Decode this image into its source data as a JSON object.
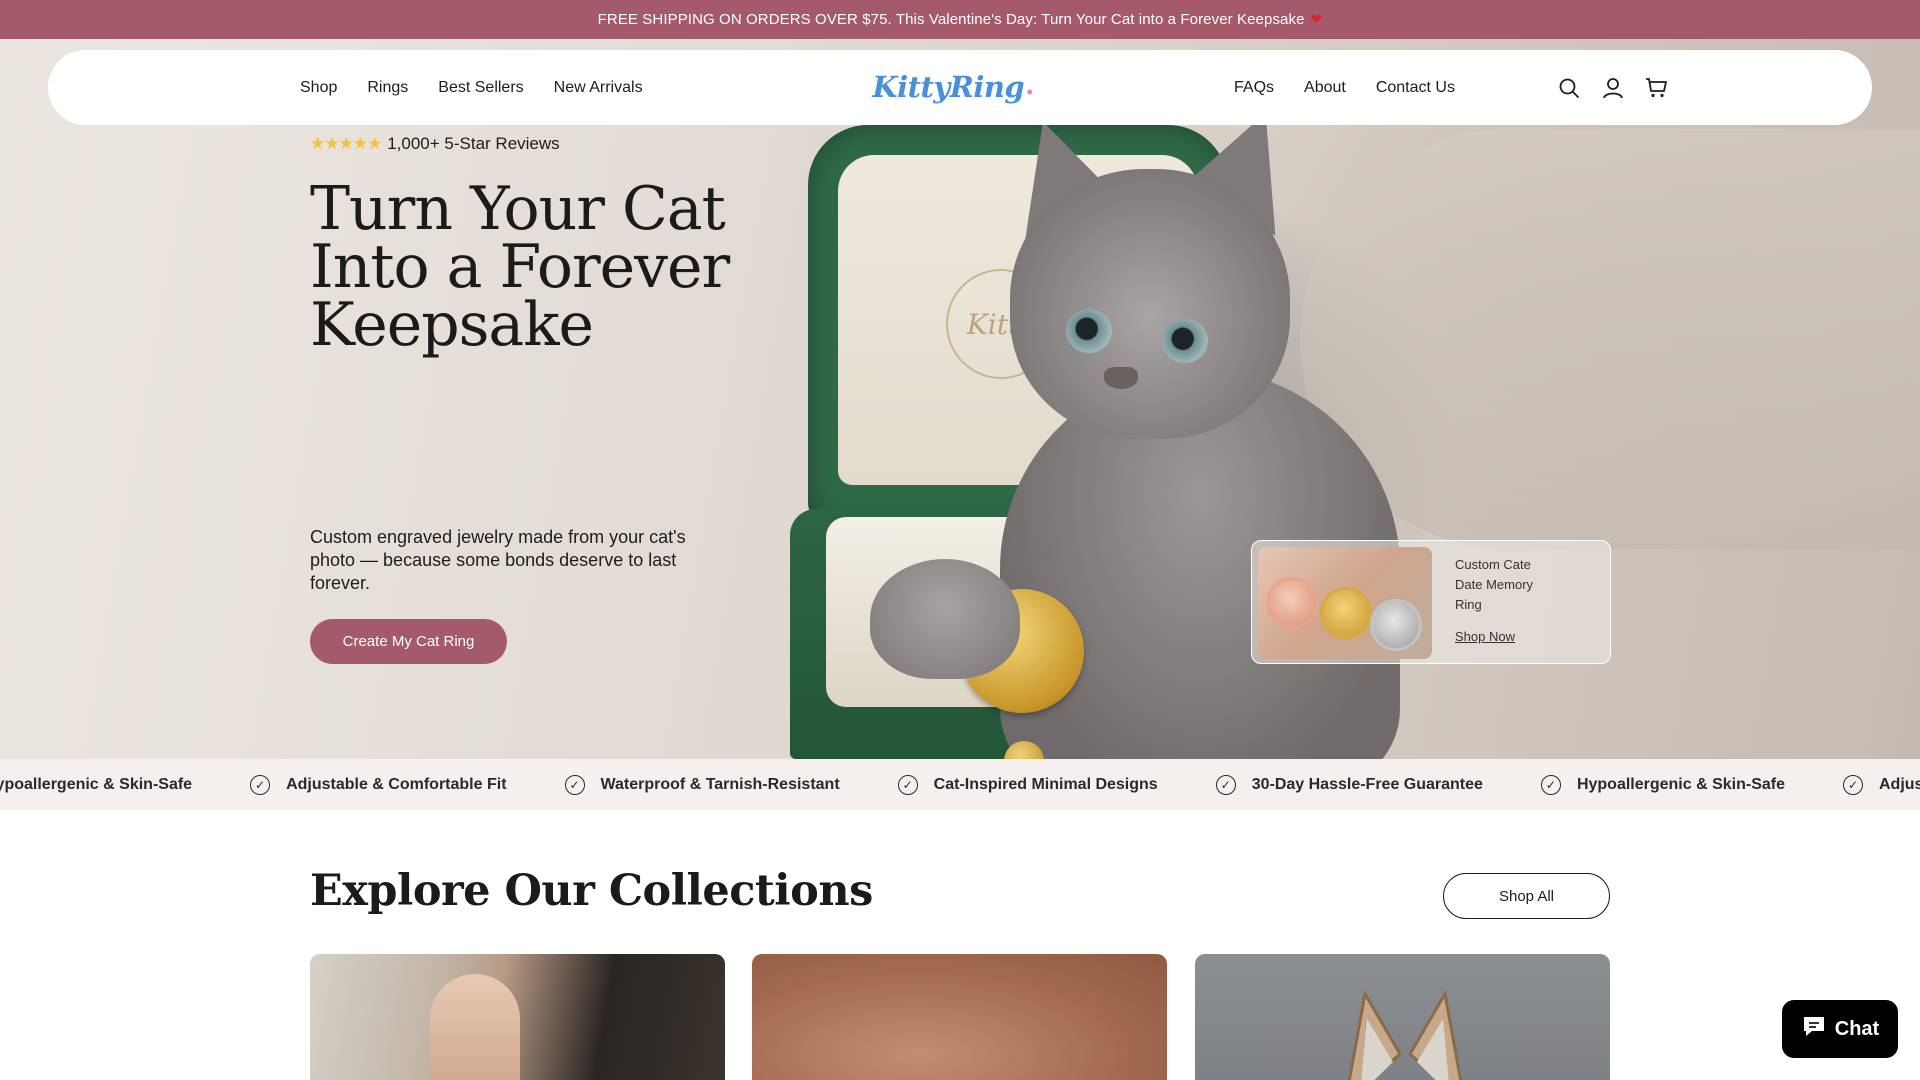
{
  "announcement": {
    "text": "FREE SHIPPING ON ORDERS OVER $75. This Valentine's Day: Turn Your Cat into a Forever Keepsake",
    "heart": "❤"
  },
  "nav": {
    "left_links": [
      "Shop",
      "Rings",
      "Best Sellers",
      "New Arrivals"
    ],
    "right_links": [
      "FAQs",
      "About",
      "Contact Us"
    ],
    "logo_text": "KittyRing",
    "icons": [
      "search-icon",
      "account-icon",
      "cart-icon"
    ]
  },
  "hero": {
    "stars": "★★★★★",
    "rating_text": "1,000+ 5-Star Reviews",
    "headline": "Turn Your Cat Into a Forever Keepsake",
    "subtext": "Custom engraved jewelry made from your cat's photo — because some bonds deserve to last forever.",
    "cta": "Create My Cat Ring",
    "box_logo": "Kitty"
  },
  "promo": {
    "title": "Custom Cate Date Memory Ring",
    "link": "Shop Now"
  },
  "features": [
    "Hypoallergenic & Skin-Safe",
    "Adjustable & Comfortable Fit",
    "Waterproof & Tarnish-Resistant",
    "Cat-Inspired Minimal Designs",
    "30-Day Hassle-Free Guarantee",
    "Hypoallergenic & Skin-Safe",
    "Adjustable & Comfortable Fit"
  ],
  "collections": {
    "title": "Explore Our Collections",
    "shop_all": "Shop All"
  },
  "chat": {
    "label": "Chat"
  },
  "colors": {
    "brand": "#a55a6b",
    "strip_bg": "#f5f0ed",
    "logo_blue": "#4a8fdb"
  }
}
